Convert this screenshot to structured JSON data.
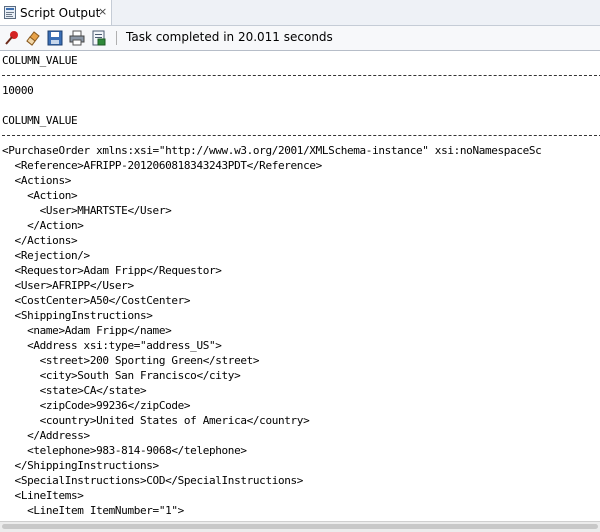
{
  "tab": {
    "title": "Script Output",
    "close_label": "×"
  },
  "toolbar": {
    "status": "Task completed in 20.011 seconds"
  },
  "output": {
    "lines": [
      "COLUMN_VALUE",
      "",
      "10000",
      "",
      "COLUMN_VALUE",
      "",
      "<PurchaseOrder xmlns:xsi=\"http://www.w3.org/2001/XMLSchema-instance\" xsi:noNamespaceSc",
      "  <Reference>AFRIPP-2012060818343243PDT</Reference>",
      "  <Actions>",
      "    <Action>",
      "      <User>MHARTSTE</User>",
      "    </Action>",
      "  </Actions>",
      "  <Rejection/>",
      "  <Requestor>Adam Fripp</Requestor>",
      "  <User>AFRIPP</User>",
      "  <CostCenter>A50</CostCenter>",
      "  <ShippingInstructions>",
      "    <name>Adam Fripp</name>",
      "    <Address xsi:type=\"address_US\">",
      "      <street>200 Sporting Green</street>",
      "      <city>South San Francisco</city>",
      "      <state>CA</state>",
      "      <zipCode>99236</zipCode>",
      "      <country>United States of America</country>",
      "    </Address>",
      "    <telephone>983-814-9068</telephone>",
      "  </ShippingInstructions>",
      "  <SpecialInstructions>COD</SpecialInstructions>",
      "  <LineItems>",
      "    <LineItem ItemNumber=\"1\">"
    ]
  }
}
